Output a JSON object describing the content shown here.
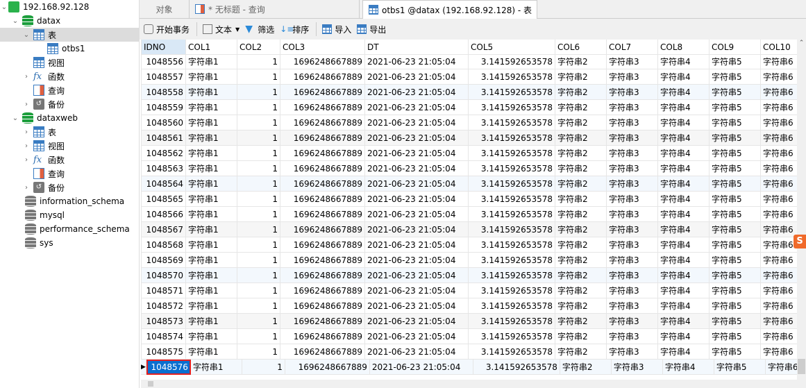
{
  "sidebar": {
    "server": "192.168.92.128",
    "items": [
      {
        "label": "datax",
        "icon": "database-icon",
        "level": 1,
        "chev": "v"
      },
      {
        "label": "表",
        "icon": "table-icon",
        "level": 2,
        "chev": "v",
        "selected": true
      },
      {
        "label": "otbs1",
        "icon": "table-icon",
        "level": 3,
        "chev": ""
      },
      {
        "label": "视图",
        "icon": "view-icon",
        "level": 2,
        "chev": ""
      },
      {
        "label": "函数",
        "icon": "function-icon",
        "level": 2,
        "chev": ">"
      },
      {
        "label": "查询",
        "icon": "query-icon",
        "level": 2,
        "chev": ""
      },
      {
        "label": "备份",
        "icon": "backup-icon",
        "level": 2,
        "chev": ">"
      },
      {
        "label": "dataxweb",
        "icon": "database-icon",
        "level": 1,
        "chev": "v"
      },
      {
        "label": "表",
        "icon": "table-icon",
        "level": 2,
        "chev": ">"
      },
      {
        "label": "视图",
        "icon": "view-icon",
        "level": 2,
        "chev": ">"
      },
      {
        "label": "函数",
        "icon": "function-icon",
        "level": 2,
        "chev": ">"
      },
      {
        "label": "查询",
        "icon": "query-icon",
        "level": 2,
        "chev": ""
      },
      {
        "label": "备份",
        "icon": "backup-icon",
        "level": 2,
        "chev": ">"
      },
      {
        "label": "information_schema",
        "icon": "database-gray-icon",
        "level": 1,
        "chev": ""
      },
      {
        "label": "mysql",
        "icon": "database-gray-icon",
        "level": 1,
        "chev": ""
      },
      {
        "label": "performance_schema",
        "icon": "database-gray-icon",
        "level": 1,
        "chev": ""
      },
      {
        "label": "sys",
        "icon": "database-gray-icon",
        "level": 1,
        "chev": ""
      }
    ]
  },
  "tabs": [
    {
      "label": "对象"
    },
    {
      "label": "* 无标题 - 查询"
    },
    {
      "label": "otbs1 @datax (192.168.92.128) - 表",
      "active": true
    }
  ],
  "toolbar": {
    "begin_tx": "开始事务",
    "text": "文本",
    "filter": "筛选",
    "sort": "排序",
    "import": "导入",
    "export": "导出"
  },
  "grid": {
    "columns": [
      "IDNO",
      "COL1",
      "COL2",
      "COL3",
      "DT",
      "COL5",
      "COL6",
      "COL7",
      "COL8",
      "COL9",
      "COL10"
    ],
    "rows_idno": [
      1048556,
      1048557,
      1048558,
      1048559,
      1048560,
      1048561,
      1048562,
      1048563,
      1048564,
      1048565,
      1048566,
      1048567,
      1048568,
      1048569,
      1048570,
      1048571,
      1048572,
      1048573,
      1048574,
      1048575,
      1048576
    ],
    "row_values": {
      "COL1": "字符串1",
      "COL2": "1",
      "COL3": "1696248667889",
      "DT": "2021-06-23 21:05:04",
      "COL5": "3.141592653578",
      "COL6": "字符串2",
      "COL7": "字符串3",
      "COL8": "字符串4",
      "COL9": "字符串5",
      "COL10": "字符串6"
    },
    "current_row": 1048576
  },
  "ime_badge": "S"
}
